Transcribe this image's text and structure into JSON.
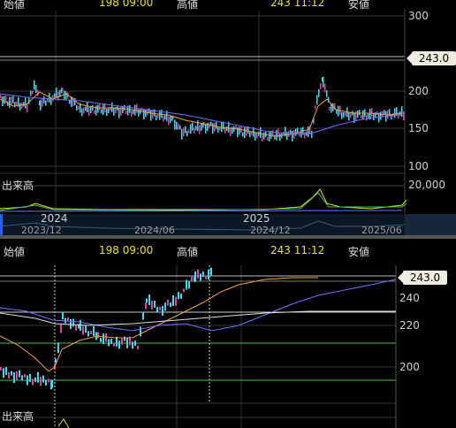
{
  "header_top": {
    "open_label": "始値",
    "open_value": "198",
    "open_time": "09:00",
    "high_label": "高値",
    "high_value": "243",
    "high_time": "11:12",
    "low_label": "安値"
  },
  "header_bottom": {
    "open_label": "始値",
    "open_value": "198",
    "open_time": "09:00",
    "high_label": "高値",
    "high_value": "243",
    "high_time": "11:12",
    "low_label": "安値"
  },
  "top_axis": [
    "300",
    "200",
    "150",
    "100"
  ],
  "top_price_tag": "243.0",
  "top_volume": {
    "label": "出来高",
    "max": "20,000"
  },
  "navigator": {
    "years": [
      "2024",
      "2025"
    ],
    "dates": [
      "2023/12",
      "2024/06",
      "2024/12",
      "2025/06"
    ]
  },
  "bottom_axis": [
    "240",
    "220",
    "200"
  ],
  "bottom_price_tag": "243.0",
  "bottom_volume": {
    "label": "出来高"
  },
  "colors": {
    "up": "#e040a0",
    "down": "#40d8f0",
    "ma_short": "#f0a040",
    "ma_long": "#7070ff",
    "value_yellow": "#e8e020"
  }
}
